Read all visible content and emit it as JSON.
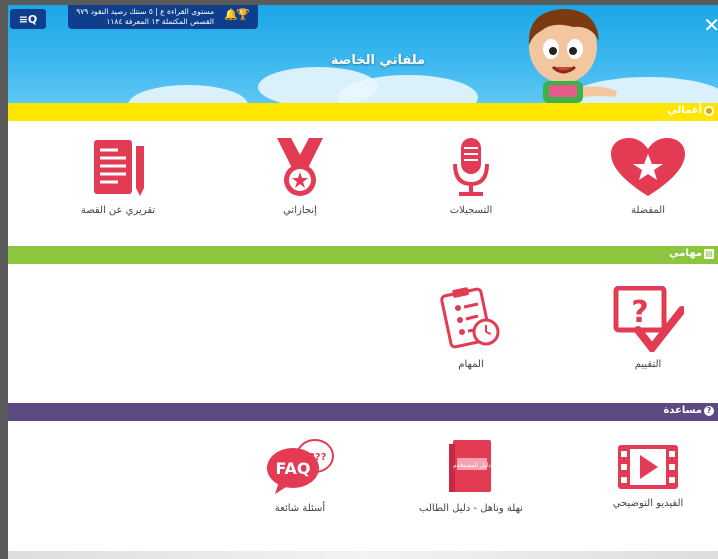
{
  "header": {
    "title": "ملفاتي الخاصة",
    "menu_label": "≡Q",
    "close_label": "✕",
    "stats": {
      "reading_level": "مستوى القراءة",
      "level_value": "ع | ٥ سنتك",
      "coins_label": "رصيد النقود",
      "coins_value": "٩٧٩",
      "stories_label": "القصص المكتملة",
      "stories_value": "١٣",
      "knowledge_label": "المعرفة",
      "knowledge_value": "١١٨٤"
    }
  },
  "sections": {
    "my_work": {
      "label": "أعمالي",
      "items": {
        "favorites": "المفضلة",
        "recordings": "التسجيلات",
        "achievements": "إنجازاتي",
        "story_report": "تقريري عن القصة"
      }
    },
    "my_tasks": {
      "label": "مهامي",
      "items": {
        "assessment": "التقييم",
        "tasks": "المهام"
      }
    },
    "help": {
      "label": "مساعدة",
      "items": {
        "tutorial_video": "الفيديو التوضيحي",
        "student_guide": "نهلة وناهل - دليل الطالب",
        "faq": "أسئلة شائعة",
        "guide_cover_text": "دليل المستخدم"
      }
    }
  },
  "colors": {
    "header_blue": "#1aa6e8",
    "work_band": "#ffe600",
    "tasks_band": "#8cc63f",
    "help_band": "#5e4a82",
    "icon_red": "#e33b54"
  }
}
